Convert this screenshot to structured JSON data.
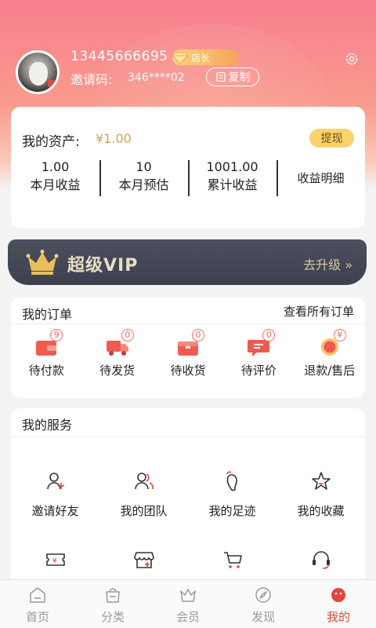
{
  "profile": {
    "phone": "13445666695",
    "badge": "店长",
    "invite_label": "邀请码:",
    "invite_code": "346****02",
    "copy_label": "复制"
  },
  "assets": {
    "label": "我的资产:",
    "amount": "¥1.00",
    "withdraw_label": "提现",
    "stats": [
      {
        "value": "1.00",
        "label": "本月收益"
      },
      {
        "value": "10",
        "label": "本月预估"
      },
      {
        "value": "1001.00",
        "label": "累计收益"
      },
      {
        "label": "收益明细"
      }
    ]
  },
  "vip": {
    "title": "超级VIP",
    "upgrade_label": "去升级 »"
  },
  "orders": {
    "title": "我的订单",
    "all_label": "查看所有订单",
    "items": [
      {
        "label": "待付款",
        "count": "9",
        "icon": "wallet-icon"
      },
      {
        "label": "待发货",
        "count": "0",
        "icon": "truck-icon"
      },
      {
        "label": "待收货",
        "count": "0",
        "icon": "package-icon"
      },
      {
        "label": "待评价",
        "count": "0",
        "icon": "comment-icon"
      },
      {
        "label": "退款/售后",
        "count": "¥",
        "icon": "refund-icon"
      }
    ]
  },
  "services": {
    "title": "我的服务",
    "items": [
      {
        "label": "邀请好友",
        "icon": "invite-friend-icon"
      },
      {
        "label": "我的团队",
        "icon": "team-icon"
      },
      {
        "label": "我的足迹",
        "icon": "footprint-icon"
      },
      {
        "label": "我的收藏",
        "icon": "star-icon"
      },
      {
        "label": "",
        "icon": "ticket-icon"
      },
      {
        "label": "",
        "icon": "store-icon"
      },
      {
        "label": "",
        "icon": "cart-icon"
      },
      {
        "label": "",
        "icon": "headset-icon"
      }
    ]
  },
  "tabbar": {
    "items": [
      {
        "label": "首页",
        "icon": "home-icon"
      },
      {
        "label": "分类",
        "icon": "category-icon"
      },
      {
        "label": "会员",
        "icon": "crown-icon"
      },
      {
        "label": "发现",
        "icon": "compass-icon"
      },
      {
        "label": "我的",
        "icon": "profile-icon"
      }
    ],
    "active_index": 4
  },
  "colors": {
    "accent": "#e2463b",
    "gold": "#d9a24f",
    "vip_bg": "#3d404f",
    "hero_top": "#f77f8e"
  }
}
